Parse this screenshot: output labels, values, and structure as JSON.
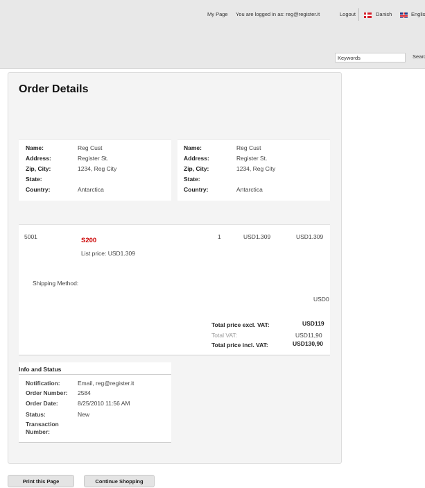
{
  "header": {
    "my_page": "My Page",
    "logged_in_text": "You are logged in as: reg@register.it",
    "logout": "Logout",
    "languages": [
      {
        "label": "Danish",
        "icon": "danish-flag-icon"
      },
      {
        "label": "English",
        "icon": "english-flag-icon"
      }
    ],
    "search": {
      "placeholder": "Keywords",
      "button_label": "Search"
    }
  },
  "page": {
    "title": "Order Details"
  },
  "addresses": {
    "labels": {
      "name": "Name:",
      "address": "Address:",
      "zip_city": "Zip, City:",
      "state": "State:",
      "country": "Country:"
    },
    "billing": {
      "name": "Reg Cust",
      "address": "Register St.",
      "zip_city": "1234, Reg City",
      "state": "",
      "country": "Antarctica"
    },
    "shipping": {
      "name": "Reg Cust",
      "address": "Register St.",
      "zip_city": "1234, Reg City",
      "state": "",
      "country": "Antarctica"
    }
  },
  "order": {
    "line": {
      "sku": "5001",
      "product": "S200",
      "list_price": "List price: USD1.309",
      "quantity": "1",
      "unit_price": "USD1.309",
      "total": "USD1.309"
    },
    "shipping_method_label": "Shipping Method:",
    "shipping_cost": "USD0",
    "totals": {
      "excl_label": "Total price excl. VAT:",
      "excl_value": "USD119",
      "vat_label": "Total VAT:",
      "vat_value": "USD11,90",
      "incl_label": "Total price incl. VAT:",
      "incl_value": "USD130,90"
    }
  },
  "info": {
    "title": "Info and Status",
    "notification_label": "Notification:",
    "notification_value": "Email, reg@register.it",
    "order_number_label": "Order Number:",
    "order_number_value": "2584",
    "order_date_label": "Order Date:",
    "order_date_value": "8/25/2010 11:56 AM",
    "status_label": "Status:",
    "status_value": "New",
    "transaction_label_1": "Transaction",
    "transaction_label_2": "Number:"
  },
  "buttons": {
    "print": "Print this Page",
    "continue": "Continue Shopping"
  }
}
